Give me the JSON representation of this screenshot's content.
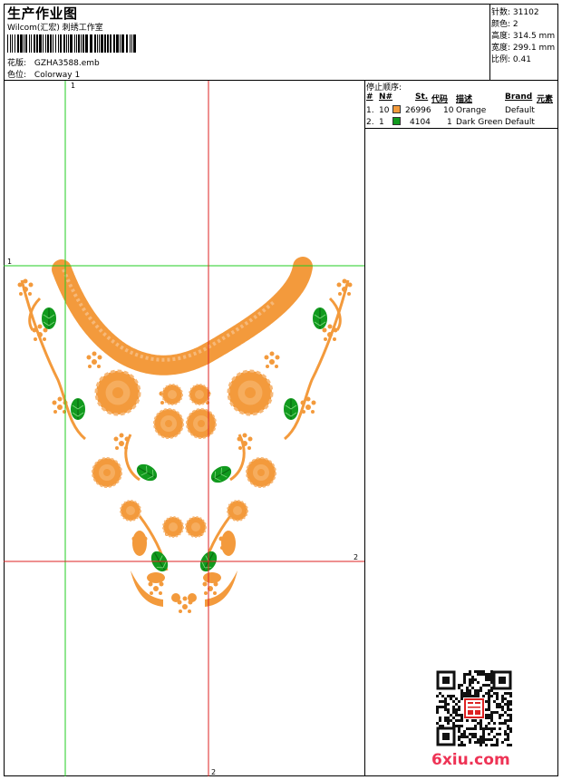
{
  "header": {
    "title": "生产作业图",
    "studio": "Wilcom(汇宏) 刺绣工作室",
    "design_label": "花版:",
    "design_file": "GZHA3588.emb",
    "colorway_label": "色位:",
    "colorway": "Colorway 1"
  },
  "specs": [
    {
      "label": "针数:",
      "value": "31102"
    },
    {
      "label": "颜色:",
      "value": "2"
    },
    {
      "label": "高度:",
      "value": "314.5 mm"
    },
    {
      "label": "宽度:",
      "value": "299.1 mm"
    },
    {
      "label": "比例:",
      "value": "0.41"
    }
  ],
  "stop_sequence": {
    "title": "停止顺序:",
    "columns": [
      "#",
      "N#",
      "St.",
      "代码",
      "描述",
      "Brand",
      "元素"
    ],
    "rows": [
      {
        "index": "1.",
        "needle": "10",
        "swatch": "#f39a3c",
        "stitches": "26996",
        "code": "10",
        "description": "Orange",
        "brand": "Default"
      },
      {
        "index": "2.",
        "needle": "1",
        "swatch": "#119a1e",
        "stitches": "4104",
        "code": "1",
        "description": "Dark Green",
        "brand": "Default"
      }
    ]
  },
  "guides": {
    "green_label_v": "1",
    "green_label_h": "1",
    "red_label_h": "2",
    "red_label_v": "2"
  },
  "colors": {
    "orange": "#f39a3c",
    "green": "#119a1e",
    "guide_green": "#22cc22",
    "guide_red": "#dd2222"
  },
  "watermark": "6xiu.com",
  "qr_stamp_icon": "qr-code-with-seal-icon"
}
